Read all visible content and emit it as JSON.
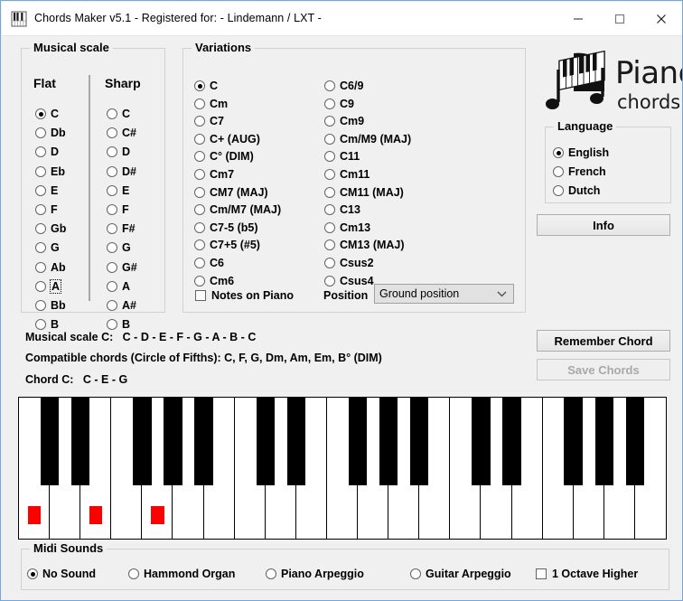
{
  "window": {
    "title": "Chords Maker v5.1 - Registered for: - Lindemann / LXT -",
    "icon": "piano-keys-icon",
    "minimize_label": "minimize-icon",
    "maximize_label": "maximize-icon",
    "close_label": "close-icon",
    "border_color": "#6fa8dc",
    "background": "#f0f0f0"
  },
  "musical_scale": {
    "title": "Musical scale",
    "flat_header": "Flat",
    "sharp_header": "Sharp",
    "flat_notes": [
      "C",
      "Db",
      "D",
      "Eb",
      "E",
      "F",
      "Gb",
      "G",
      "Ab",
      "A",
      "Bb",
      "B"
    ],
    "sharp_notes": [
      "C",
      "C#",
      "D",
      "D#",
      "E",
      "F",
      "F#",
      "G",
      "G#",
      "A",
      "A#",
      "B"
    ],
    "flat_selected": "C",
    "flat_focused": "A",
    "sharp_selected": null
  },
  "variations": {
    "title": "Variations",
    "left_column": [
      "C",
      "Cm",
      "C7",
      "C+ (AUG)",
      "C° (DIM)",
      "Cm7",
      "CM7 (MAJ)",
      "Cm/M7 (MAJ)",
      "C7-5 (b5)",
      "C7+5 (#5)",
      "C6",
      "Cm6"
    ],
    "right_column": [
      "C6/9",
      "C9",
      "Cm9",
      "Cm/M9 (MAJ)",
      "C11",
      "Cm11",
      "CM11 (MAJ)",
      "C13",
      "Cm13",
      "CM13 (MAJ)",
      "Csus2",
      "Csus4"
    ],
    "selected": "C",
    "notes_on_piano_label": "Notes on Piano",
    "notes_on_piano_checked": false,
    "position_label": "Position",
    "position_value": "Ground position"
  },
  "branding": {
    "logo_title": "Piano",
    "logo_subtitle": "chords"
  },
  "language": {
    "title": "Language",
    "options": [
      "English",
      "French",
      "Dutch"
    ],
    "selected": "English"
  },
  "buttons": {
    "info": "Info",
    "remember_chord": "Remember Chord",
    "save_chords": "Save Chords",
    "save_chords_enabled": false
  },
  "info_lines": {
    "scale": "Musical scale C:   C - D - E - F - G - A - B - C",
    "compatible": "Compatible chords (Circle of Fifths): C, F, G, Dm, Am, Em, B° (DIM)",
    "chord": "Chord C:   C - E - G"
  },
  "piano": {
    "white_key_count": 21,
    "highlighted_notes": [
      "C",
      "E",
      "G"
    ],
    "marker_color": "#ff0000",
    "white_key_color": "#ffffff",
    "black_key_color": "#000000",
    "highlighted_white_key_indices": [
      0,
      2,
      4
    ],
    "black_key_positions": [
      0,
      1,
      3,
      4,
      5,
      7,
      8,
      10,
      11,
      12,
      14,
      15,
      17,
      18,
      19
    ]
  },
  "midi_sounds": {
    "title": "Midi Sounds",
    "options": [
      "No Sound",
      "Hammond Organ",
      "Piano Arpeggio",
      "Guitar Arpeggio"
    ],
    "selected": "No Sound",
    "octave_label": "1 Octave Higher",
    "octave_checked": false
  }
}
